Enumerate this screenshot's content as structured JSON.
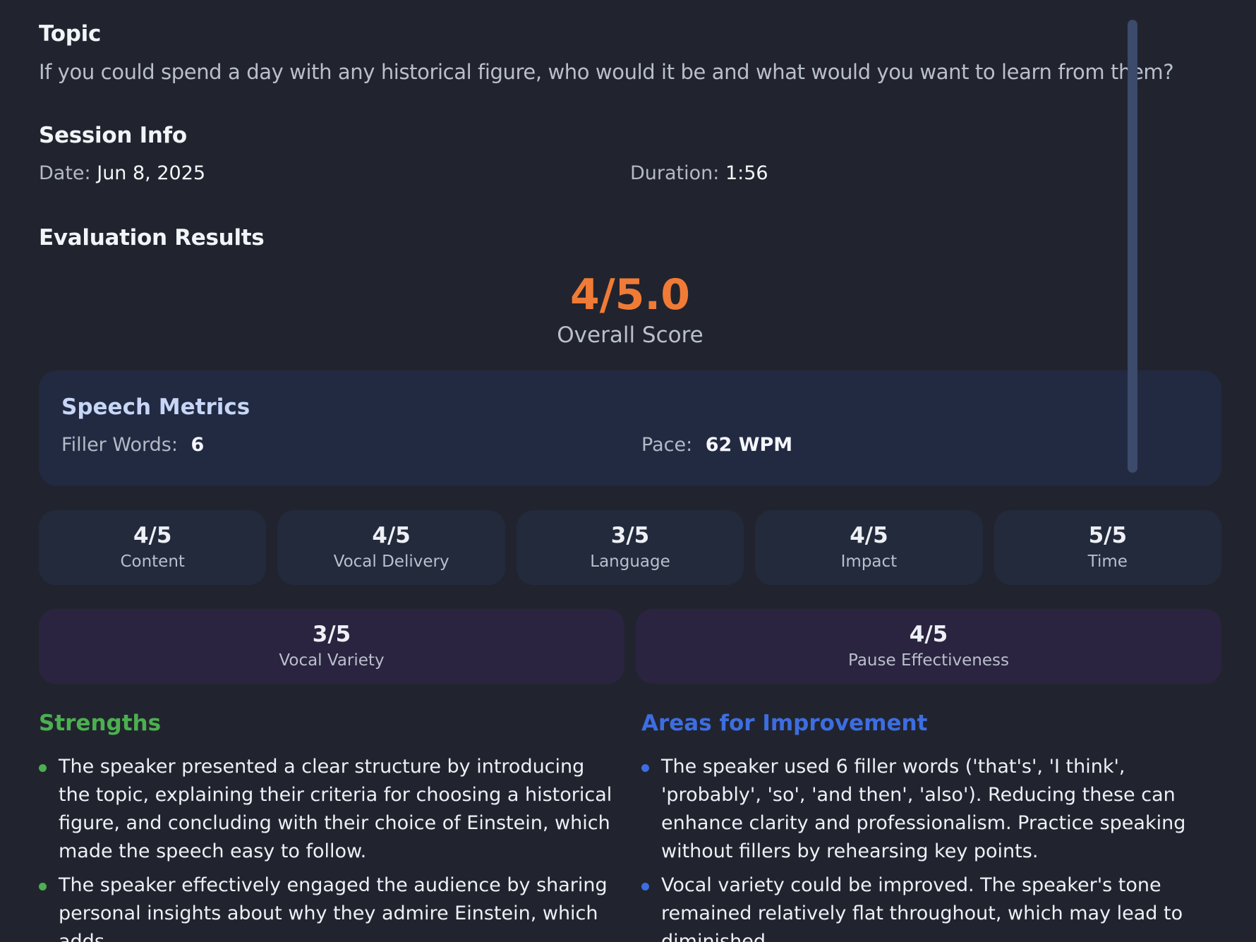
{
  "topic": {
    "heading": "Topic",
    "text": "If you could spend a day with any historical figure, who would it be and what would you want to learn from them?"
  },
  "session": {
    "heading": "Session Info",
    "date_label": "Date:",
    "date_value": "Jun 8, 2025",
    "duration_label": "Duration:",
    "duration_value": "1:56"
  },
  "evaluation": {
    "heading": "Evaluation Results",
    "overall_value": "4/5.0",
    "overall_label": "Overall Score",
    "accent_color": "#f07b36"
  },
  "speech_metrics": {
    "heading": "Speech Metrics",
    "filler_label": "Filler Words:",
    "filler_value": "6",
    "pace_label": "Pace:",
    "pace_value": "62 WPM"
  },
  "scores": [
    {
      "value": "4/5",
      "label": "Content"
    },
    {
      "value": "4/5",
      "label": "Vocal Delivery"
    },
    {
      "value": "3/5",
      "label": "Language"
    },
    {
      "value": "4/5",
      "label": "Impact"
    },
    {
      "value": "5/5",
      "label": "Time"
    }
  ],
  "voice_scores": [
    {
      "value": "3/5",
      "label": "Vocal Variety"
    },
    {
      "value": "4/5",
      "label": "Pause Effectiveness"
    }
  ],
  "strengths": {
    "heading": "Strengths",
    "color": "#4caf50",
    "items": [
      "The speaker presented a clear structure by introducing the topic, explaining their criteria for choosing a historical figure, and concluding with their choice of Einstein, which made the speech easy to follow.",
      "The speaker effectively engaged the audience by sharing personal insights about why they admire Einstein, which adds"
    ]
  },
  "improvements": {
    "heading": "Areas for Improvement",
    "color": "#3d6de0",
    "items": [
      "The speaker used 6 filler words ('that's', 'I think', 'probably', 'so', 'and then', 'also'). Reducing these can enhance clarity and professionalism. Practice speaking without fillers by rehearsing key points.",
      "Vocal variety could be improved. The speaker's tone remained relatively flat throughout, which may lead to diminished"
    ]
  }
}
